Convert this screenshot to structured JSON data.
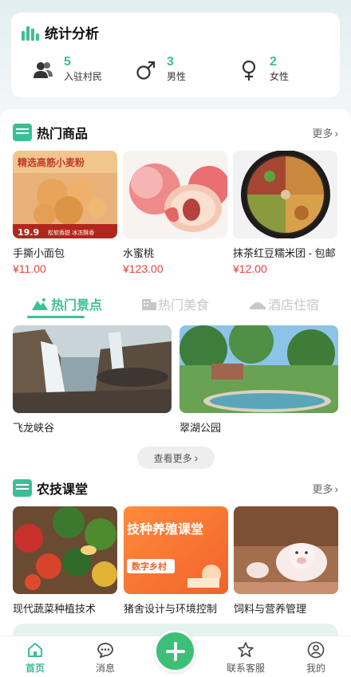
{
  "stats": {
    "title": "统计分析",
    "items": [
      {
        "value": "5",
        "label": "入驻村民",
        "icon": "people-icon"
      },
      {
        "value": "3",
        "label": "男性",
        "icon": "male-icon"
      },
      {
        "value": "2",
        "label": "女性",
        "icon": "female-icon"
      }
    ]
  },
  "hot_products": {
    "title": "热门商品",
    "more": "更多",
    "items": [
      {
        "name": "手撕小面包",
        "price": "¥11.00",
        "image": "bread-image",
        "image_text": "精选高筋小麦粉",
        "image_price": "19.9",
        "image_tag": "松软香甜 冰冻酥香"
      },
      {
        "name": "水蜜桃",
        "price": "¥123.00",
        "image": "peach-image"
      },
      {
        "name": "抹茶红豆糯米团 - 包邮",
        "price": "¥12.00",
        "image": "food-platter-image"
      }
    ]
  },
  "tabs": [
    {
      "label": "热门景点",
      "icon": "mountain-icon",
      "active": true
    },
    {
      "label": "热门美食",
      "icon": "building-icon",
      "active": false
    },
    {
      "label": "酒店住宿",
      "icon": "hotel-icon",
      "active": false
    }
  ],
  "scenic": {
    "items": [
      {
        "name": "飞龙峡谷",
        "image": "waterfall-image"
      },
      {
        "name": "翠湖公园",
        "image": "park-pond-image"
      }
    ],
    "see_more": "查看更多"
  },
  "courses": {
    "title": "农技课堂",
    "more": "更多",
    "items": [
      {
        "name": "现代蔬菜种植技术",
        "image": "vegetables-image"
      },
      {
        "name": "猪舍设计与环境控制",
        "image": "course-banner-image",
        "banner_title": "技种养殖课堂",
        "banner_brand": "数字乡村"
      },
      {
        "name": "饲料与营养管理",
        "image": "piglet-image"
      }
    ]
  },
  "tabbar": {
    "items": [
      {
        "label": "首页",
        "icon": "home-icon",
        "active": true
      },
      {
        "label": "消息",
        "icon": "message-icon",
        "active": false
      },
      {
        "label": "联系客服",
        "icon": "star-icon",
        "active": false
      },
      {
        "label": "我的",
        "icon": "user-icon",
        "active": false
      }
    ],
    "fab_icon": "plus-icon"
  },
  "colors": {
    "accent": "#3dbf95",
    "price": "#e8433b",
    "fab": "#3dbf78"
  }
}
